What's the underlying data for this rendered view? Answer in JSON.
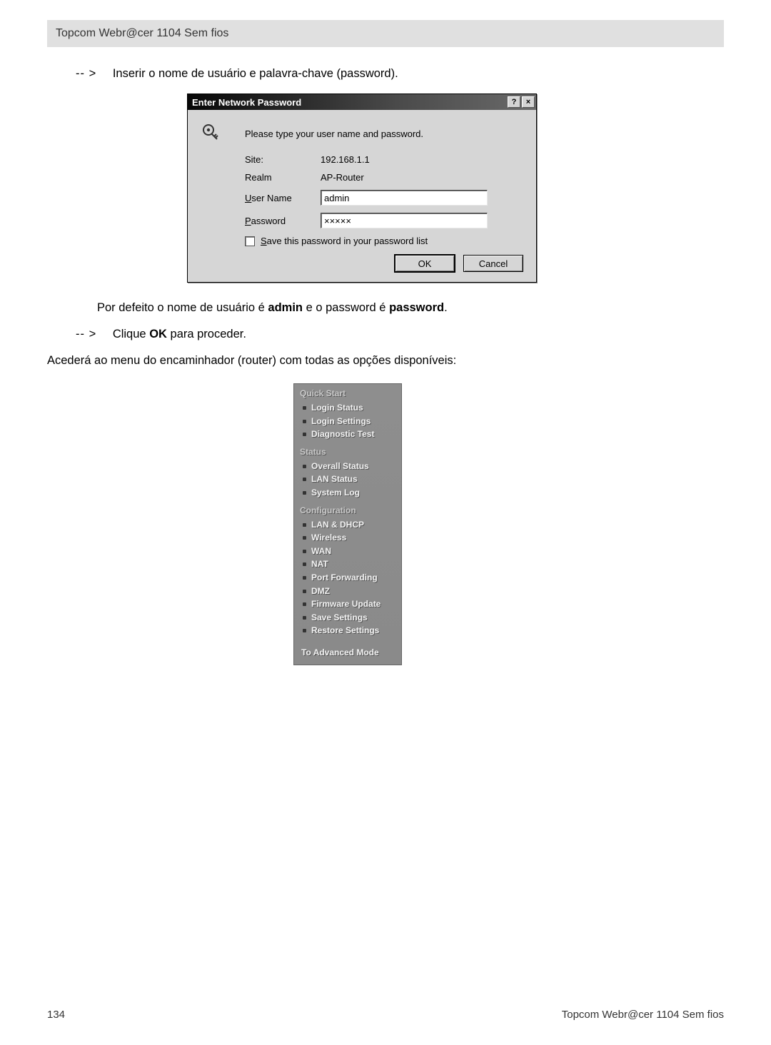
{
  "header": {
    "title": "Topcom  Webr@cer 1104 Sem fios"
  },
  "arrow": "-- >",
  "instr1": "Inserir o nome de usuário e palavra-chave (password).",
  "dialog": {
    "title": "Enter Network Password",
    "help_icon": "?",
    "close_icon": "×",
    "prompt": "Please type your user name and password.",
    "site_label": "Site:",
    "site_value": "192.168.1.1",
    "realm_label": "Realm",
    "realm_value": "AP-Router",
    "username_u": "U",
    "username_rest": "ser Name",
    "username_value": "admin",
    "password_p": "P",
    "password_rest": "assword",
    "password_value": "×××××",
    "save_s": "S",
    "save_rest": "ave this password in your password list",
    "ok": "OK",
    "cancel": "Cancel"
  },
  "text": {
    "default_pre": "Por defeito o nome de usuário é ",
    "default_admin": "admin",
    "default_mid": " e o password é ",
    "default_pw": "password",
    "default_post": ".",
    "click_pre": "Clique ",
    "click_ok": "OK",
    "click_post": " para proceder.",
    "access": "Acederá ao menu do encaminhador (router) com todas as opções disponíveis:"
  },
  "menu": {
    "sections": [
      {
        "title": "Quick Start",
        "items": [
          "Login Status",
          "Login Settings",
          "Diagnostic Test"
        ]
      },
      {
        "title": "Status",
        "items": [
          "Overall Status",
          "LAN Status",
          "System Log"
        ]
      },
      {
        "title": "Configuration",
        "items": [
          "LAN & DHCP",
          "Wireless",
          "WAN",
          "NAT",
          "Port Forwarding",
          "DMZ",
          "Firmware Update",
          "Save Settings",
          "Restore Settings"
        ]
      }
    ],
    "advanced": "To Advanced Mode"
  },
  "footer": {
    "page": "134",
    "brand": "Topcom  Webr@cer 1104 Sem fios"
  }
}
